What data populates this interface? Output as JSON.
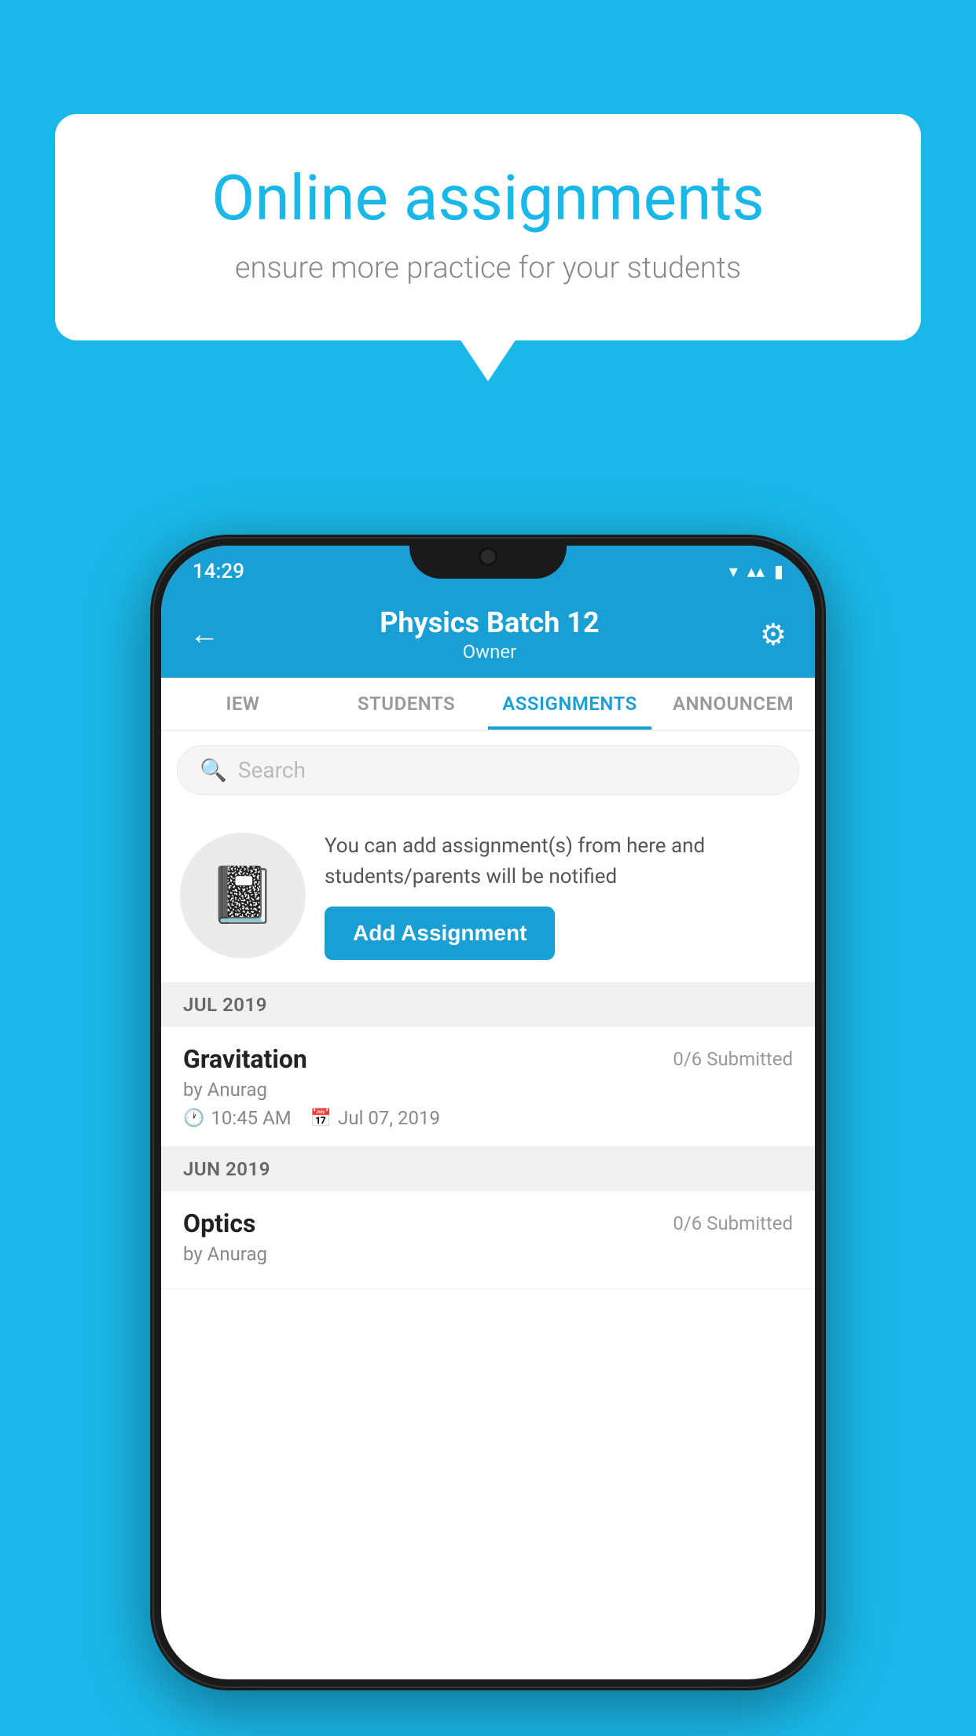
{
  "background_color": "#1ab8e8",
  "speech_bubble": {
    "title": "Online assignments",
    "subtitle": "ensure more practice for your students"
  },
  "phone": {
    "status_bar": {
      "time": "14:29",
      "icons": [
        "wifi",
        "signal",
        "battery"
      ]
    },
    "header": {
      "title": "Physics Batch 12",
      "subtitle": "Owner",
      "back_label": "←",
      "settings_label": "⚙"
    },
    "tabs": [
      {
        "label": "IEW",
        "active": false
      },
      {
        "label": "STUDENTS",
        "active": false
      },
      {
        "label": "ASSIGNMENTS",
        "active": true
      },
      {
        "label": "ANNOUNCEM",
        "active": false
      }
    ],
    "search": {
      "placeholder": "Search"
    },
    "promo": {
      "text": "You can add assignment(s) from here and students/parents will be notified",
      "button_label": "Add Assignment"
    },
    "sections": [
      {
        "month": "JUL 2019",
        "assignments": [
          {
            "name": "Gravitation",
            "submitted": "0/6 Submitted",
            "by": "by Anurag",
            "time": "10:45 AM",
            "date": "Jul 07, 2019"
          }
        ]
      },
      {
        "month": "JUN 2019",
        "assignments": [
          {
            "name": "Optics",
            "submitted": "0/6 Submitted",
            "by": "by Anurag",
            "time": "",
            "date": ""
          }
        ]
      }
    ]
  }
}
